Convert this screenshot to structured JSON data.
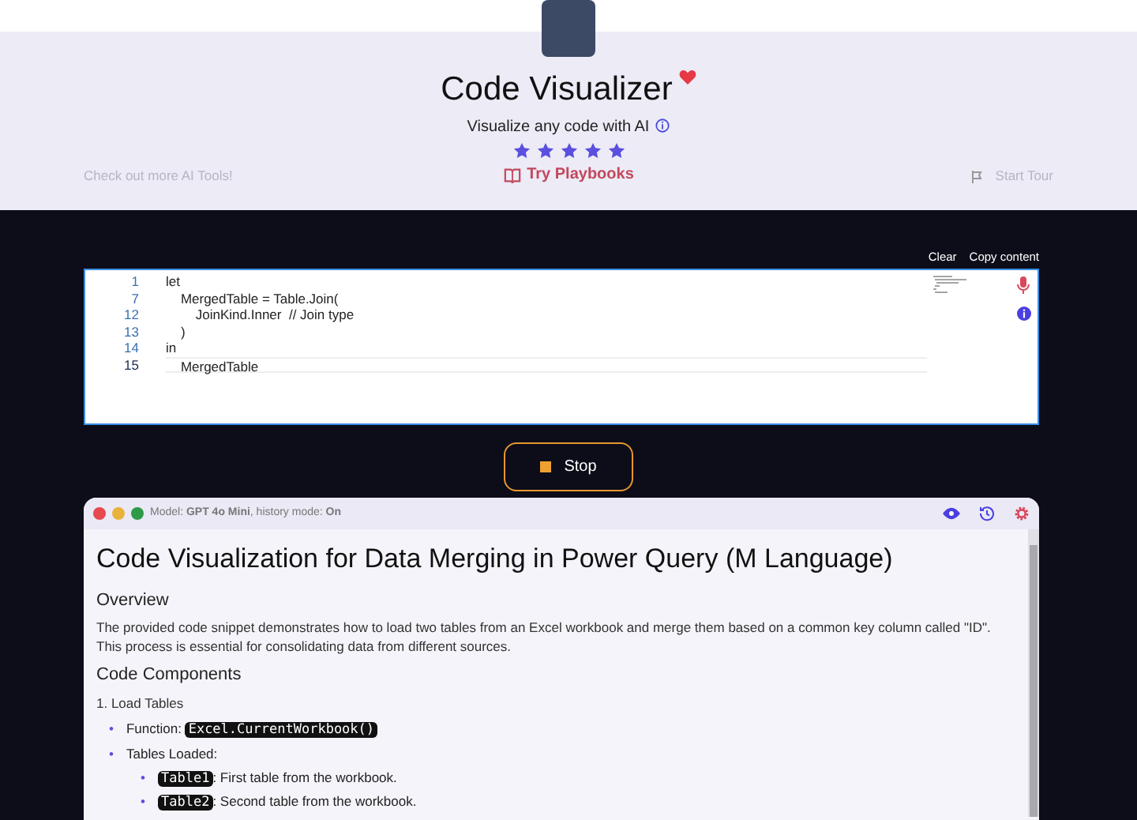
{
  "header": {
    "title": "Code Visualizer",
    "subtitle": "Visualize any code with AI",
    "stars": 5,
    "playbooks_link": "Try Playbooks",
    "more_tools_link": "Check out more AI Tools!",
    "tour_button": "Start Tour"
  },
  "editor": {
    "actions": [
      "Clear",
      "Copy content"
    ],
    "lines": [
      {
        "number": "1",
        "text": "let",
        "selected": false
      },
      {
        "number": "7",
        "text": "    MergedTable = Table.Join(",
        "selected": false
      },
      {
        "number": "12",
        "text": "        JoinKind.Inner  // Join type",
        "selected": false
      },
      {
        "number": "13",
        "text": "    )",
        "selected": false
      },
      {
        "number": "14",
        "text": "in",
        "selected": false
      },
      {
        "number": "15",
        "text": "    MergedTable",
        "selected": true
      }
    ]
  },
  "stop_button": "Stop",
  "result": {
    "status": "Model: **GPT 4o Mini**, history mode: **On**",
    "title": "Code Visualization for Data Merging in Power Query (M Language)",
    "blocks": [
      {
        "kind": "heading",
        "text": "Overview"
      },
      {
        "kind": "paragraph",
        "text": "The provided code snippet demonstrates how to load two tables from an Excel workbook and merge them based on a common key column called \"ID\". This process is essential for consolidating data from different sources."
      },
      {
        "kind": "heading",
        "text": "Code Components"
      },
      {
        "kind": "subheading",
        "text": "1. Load Tables"
      },
      {
        "kind": "list",
        "items": [
          {
            "marker": "•",
            "text": "Function:",
            "code": "Excel.CurrentWorkbook()"
          },
          {
            "marker": "•",
            "text": "Tables Loaded:",
            "children": [
              {
                "marker": "•",
                "code": "Table1",
                "text": ": First table from the workbook."
              },
              {
                "marker": "•",
                "code": "Table2",
                "text": ": Second table from the workbook."
              }
            ]
          }
        ]
      }
    ]
  }
}
